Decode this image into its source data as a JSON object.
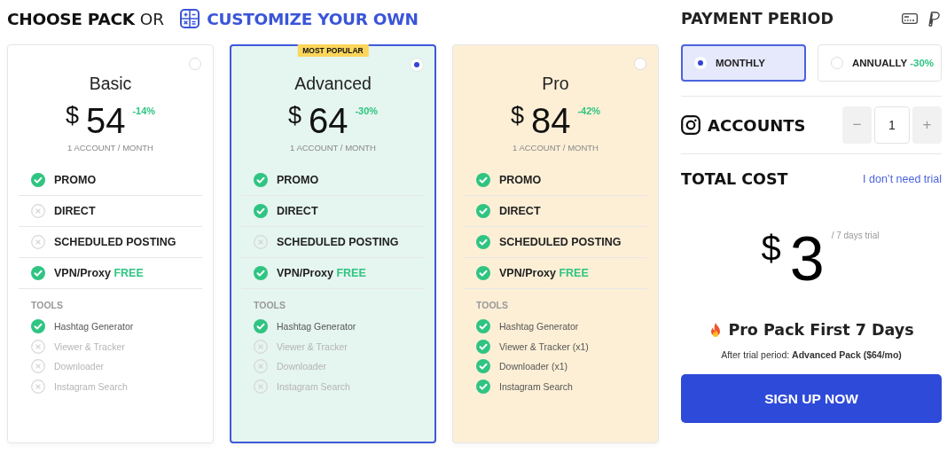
{
  "header": {
    "title": "CHOOSE PACK",
    "connector": "OR",
    "customize_link": "CUSTOMIZE YOUR OWN"
  },
  "plans": [
    {
      "name": "Basic",
      "currency": "$",
      "price": "54",
      "discount": "-14%",
      "period": "1 ACCOUNT / MONTH",
      "selected": false,
      "color": "#ffffff",
      "features": [
        {
          "label": "PROMO",
          "included": true
        },
        {
          "label": "DIRECT",
          "included": false
        },
        {
          "label": "SCHEDULED POSTING",
          "included": false
        },
        {
          "label": "VPN/Proxy",
          "tag": "FREE",
          "included": true
        }
      ],
      "tools_label": "TOOLS",
      "tools": [
        {
          "label": "Hashtag Generator",
          "included": true
        },
        {
          "label": "Viewer & Tracker",
          "included": false
        },
        {
          "label": "Downloader",
          "included": false
        },
        {
          "label": "Instagram Search",
          "included": false
        }
      ]
    },
    {
      "name": "Advanced",
      "badge": "MOST POPULAR",
      "currency": "$",
      "price": "64",
      "discount": "-30%",
      "period": "1 ACCOUNT / MONTH",
      "selected": true,
      "color": "#e5f5ef",
      "features": [
        {
          "label": "PROMO",
          "included": true
        },
        {
          "label": "DIRECT",
          "included": true
        },
        {
          "label": "SCHEDULED POSTING",
          "included": false
        },
        {
          "label": "VPN/Proxy",
          "tag": "FREE",
          "included": true
        }
      ],
      "tools_label": "TOOLS",
      "tools": [
        {
          "label": "Hashtag Generator",
          "included": true
        },
        {
          "label": "Viewer & Tracker",
          "included": false
        },
        {
          "label": "Downloader",
          "included": false
        },
        {
          "label": "Instagram Search",
          "included": false
        }
      ]
    },
    {
      "name": "Pro",
      "currency": "$",
      "price": "84",
      "discount": "-42%",
      "period": "1 ACCOUNT / MONTH",
      "selected": false,
      "color": "#fdefd6",
      "features": [
        {
          "label": "PROMO",
          "included": true
        },
        {
          "label": "DIRECT",
          "included": true
        },
        {
          "label": "SCHEDULED POSTING",
          "included": true
        },
        {
          "label": "VPN/Proxy",
          "tag": "FREE",
          "included": true
        }
      ],
      "tools_label": "TOOLS",
      "tools": [
        {
          "label": "Hashtag Generator",
          "included": true
        },
        {
          "label": "Viewer & Tracker (x1)",
          "included": true
        },
        {
          "label": "Downloader (x1)",
          "included": true
        },
        {
          "label": "Instagram Search",
          "included": true
        }
      ]
    }
  ],
  "payment": {
    "title": "PAYMENT PERIOD",
    "periods": [
      {
        "label": "MONTHLY",
        "selected": true
      },
      {
        "label": "ANNUALLY",
        "discount": "-30%",
        "selected": false
      }
    ],
    "accounts": {
      "label": "ACCOUNTS",
      "decrement": "−",
      "value": "1",
      "increment": "+"
    },
    "total": {
      "label": "TOTAL COST",
      "skip_link": "I don’t need trial",
      "currency": "$",
      "amount": "3",
      "note": "/ 7 days trial",
      "offer": "Pro Pack First 7 Days",
      "after": "After trial period: **Advanced Pack ($64/mo)**"
    },
    "signup_button": "SIGN UP NOW"
  }
}
